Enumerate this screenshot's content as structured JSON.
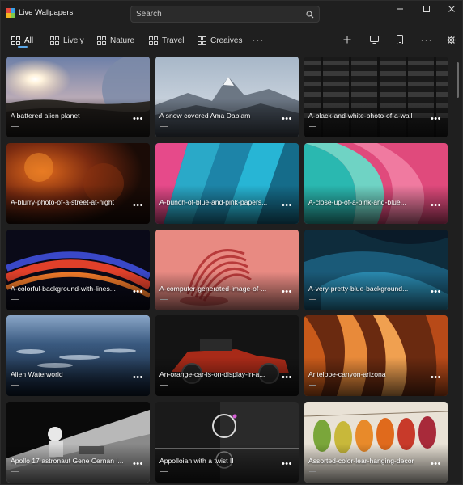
{
  "app": {
    "title": "Live Wallpapers"
  },
  "search": {
    "placeholder": "Search"
  },
  "tabs": [
    {
      "label": "All",
      "icon": "grid-icon",
      "active": true
    },
    {
      "label": "Lively",
      "icon": "grid-icon"
    },
    {
      "label": "Nature",
      "icon": "grid-icon"
    },
    {
      "label": "Travel",
      "icon": "grid-icon"
    },
    {
      "label": "Creaives",
      "icon": "grid-icon"
    }
  ],
  "toolbar": {
    "overflow_icon": "more-icon",
    "add_icon": "plus-icon",
    "desktop_icon": "monitor-icon",
    "mobile_icon": "phone-icon",
    "more_icon": "more-icon",
    "settings_icon": "gear-icon"
  },
  "colors": {
    "accent": "#5aa7e8",
    "background": "#1f1f1f"
  },
  "wallpapers": [
    {
      "title": "A battered alien planet"
    },
    {
      "title": "A snow covered Ama Dablam"
    },
    {
      "title": "A-black-and-white-photo-of-a-wall"
    },
    {
      "title": "A-blurry-photo-of-a-street-at-night"
    },
    {
      "title": "A-bunch-of-blue-and-pink-papers..."
    },
    {
      "title": "A-close-up-of-a-pink-and-blue..."
    },
    {
      "title": "A-colorful-background-with-lines..."
    },
    {
      "title": "A-computer-generated-image-of-..."
    },
    {
      "title": "A-very-pretty-blue-background..."
    },
    {
      "title": "Alien Waterworld"
    },
    {
      "title": "An-orange-car-is-on-display-in-a..."
    },
    {
      "title": "Antelope-canyon-arizona"
    },
    {
      "title": "Apollo 17 astronaut Gene Cernan i..."
    },
    {
      "title": "Appolloian with a twist II"
    },
    {
      "title": "Assorted-color-lear-hanging-decor"
    }
  ]
}
